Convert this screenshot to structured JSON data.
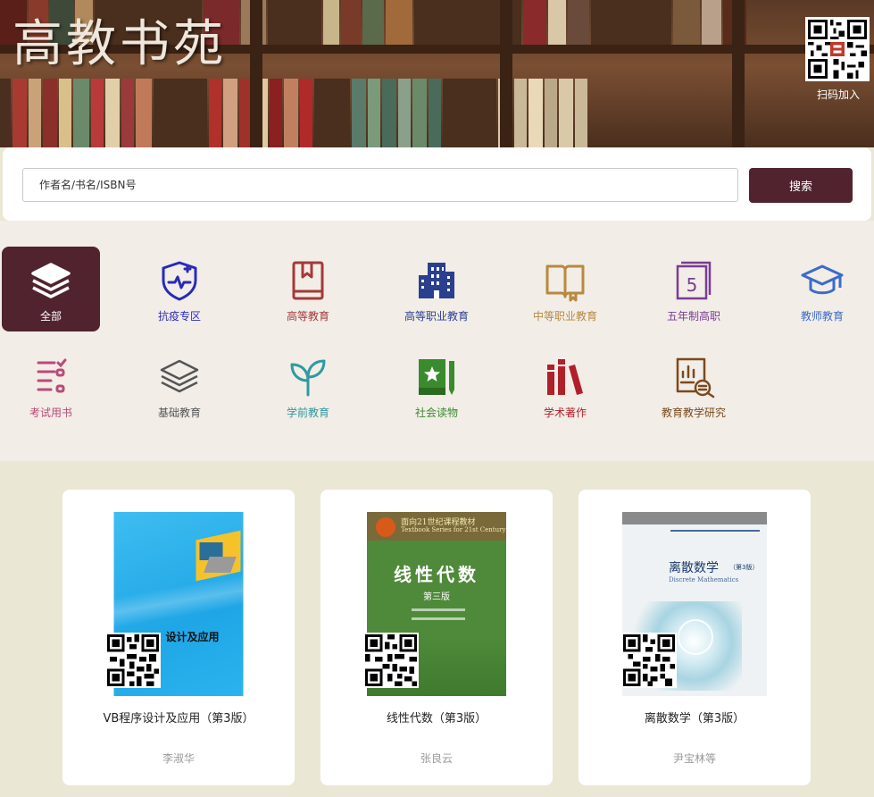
{
  "header": {
    "title": "高教书苑",
    "qr_label": "扫码加入"
  },
  "search": {
    "placeholder": "作者名/书名/ISBN号",
    "button_label": "搜索"
  },
  "categories": [
    {
      "label": "全部",
      "icon": "layers-icon",
      "color": "#ffffff",
      "active": true
    },
    {
      "label": "抗疫专区",
      "icon": "shield-heartbeat-icon",
      "color": "#2a2ab8"
    },
    {
      "label": "高等教育",
      "icon": "book-bookmark-icon",
      "color": "#a43a3a"
    },
    {
      "label": "高等职业教育",
      "icon": "building-icon",
      "color": "#2b3f8f"
    },
    {
      "label": "中等职业教育",
      "icon": "open-book-icon",
      "color": "#b8893f"
    },
    {
      "label": "五年制高职",
      "icon": "calendar-five-icon",
      "color": "#7a3c93"
    },
    {
      "label": "教师教育",
      "icon": "graduation-cap-icon",
      "color": "#3b6cc9"
    },
    {
      "label": "考试用书",
      "icon": "checklist-icon",
      "color": "#b94a7a"
    },
    {
      "label": "基础教育",
      "icon": "stack-icon",
      "color": "#555555"
    },
    {
      "label": "学前教育",
      "icon": "sprout-icon",
      "color": "#2e9aa1"
    },
    {
      "label": "社会读物",
      "icon": "star-book-icon",
      "color": "#3a8a2e"
    },
    {
      "label": "学术著作",
      "icon": "books-icon",
      "color": "#b0202a"
    },
    {
      "label": "教育教学研究",
      "icon": "research-icon",
      "color": "#7a4a1e"
    }
  ],
  "books": [
    {
      "title": "VB程序设计及应用（第3版）",
      "author": "李淑华",
      "cover_text": "设计及应用"
    },
    {
      "title": "线性代数（第3版）",
      "author": "张良云",
      "cover_text": "线性代数",
      "cover_edition": "第三版",
      "cover_series": "面向21世纪课程教材",
      "cover_series_en": "Textbook Series for 21st Century"
    },
    {
      "title": "离散数学（第3版）",
      "author": "尹宝林等",
      "cover_text": "离散数学",
      "cover_edition": "（第3版）",
      "cover_en": "Discrete Mathematics"
    }
  ]
}
